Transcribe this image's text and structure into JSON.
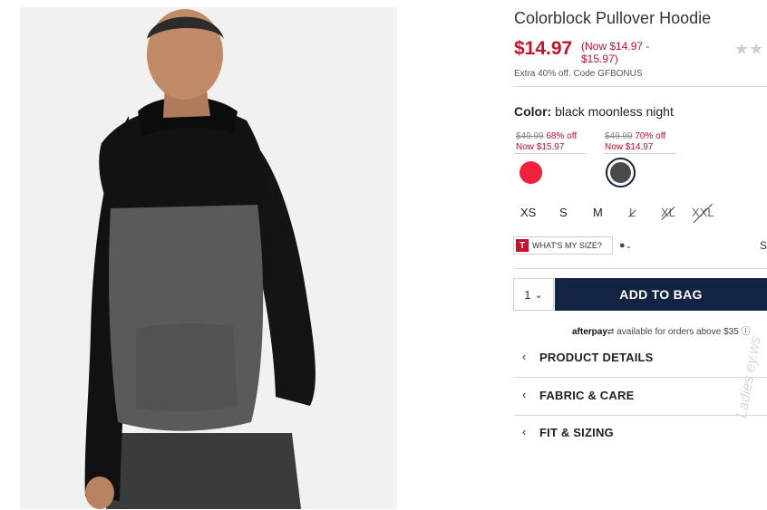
{
  "product": {
    "title": "Colorblock Pullover Hoodie",
    "price": "$14.97",
    "price_range": "(Now $14.97 - $15.97)",
    "rating_stars": "★★",
    "promo": "Extra 40% off. Code GFBONUS"
  },
  "color": {
    "label": "Color:",
    "value": "black moonless night",
    "swatches": [
      {
        "was": "$49.99",
        "pct": "68% off",
        "now": "Now $15.97",
        "color": "#f0213d"
      },
      {
        "was": "$49.99",
        "pct": "70% off",
        "now": "Now $14.97",
        "color": "#4a4a48"
      }
    ]
  },
  "sizes": [
    {
      "label": "XS",
      "available": true
    },
    {
      "label": "S",
      "available": true
    },
    {
      "label": "M",
      "available": true
    },
    {
      "label": "L",
      "available": false
    },
    {
      "label": "XL",
      "available": false
    },
    {
      "label": "XXL",
      "available": false
    }
  ],
  "size_help": {
    "badge": "T",
    "label": "WHAT'S MY SIZE?",
    "right_text": "S"
  },
  "cart": {
    "quantity": "1",
    "add_label": "ADD TO BAG"
  },
  "afterpay": {
    "brand": "afterpay",
    "text": "available for orders above $35",
    "info": "ⓘ"
  },
  "accordion": [
    {
      "label": "PRODUCT DETAILS"
    },
    {
      "label": "FABRIC & CARE"
    },
    {
      "label": "FIT & SIZING"
    }
  ],
  "watermark": "Ladies ey.ws",
  "colors": {
    "price_red": "#c8102e",
    "button_navy": "#122344"
  }
}
